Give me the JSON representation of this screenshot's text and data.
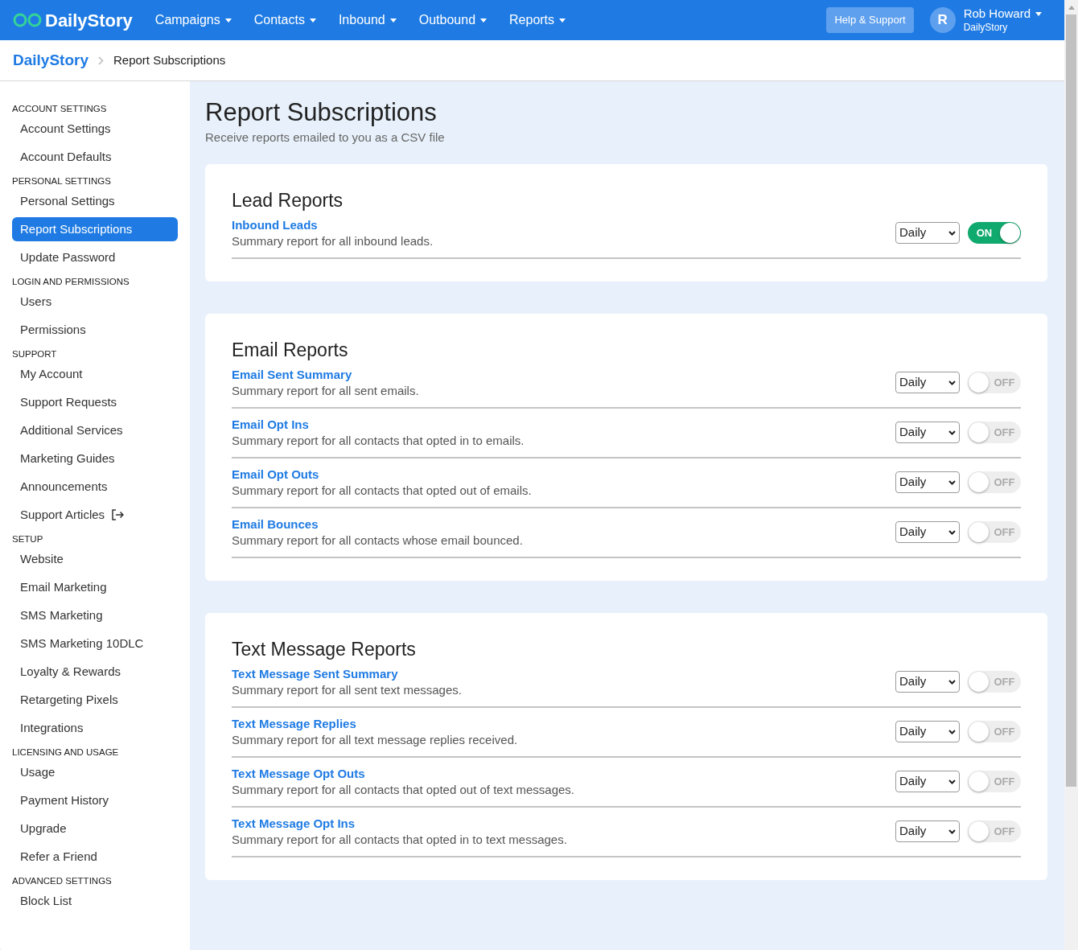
{
  "header": {
    "brand": "DailyStory",
    "nav": [
      "Campaigns",
      "Contacts",
      "Inbound",
      "Outbound",
      "Reports"
    ],
    "help_button": "Help & Support",
    "user": {
      "initial": "R",
      "name": "Rob Howard",
      "org": "DailyStory"
    }
  },
  "breadcrumb": {
    "root": "DailyStory",
    "current": "Report Subscriptions"
  },
  "sidebar": [
    {
      "heading": "ACCOUNT SETTINGS",
      "items": [
        {
          "label": "Account Settings",
          "selected": false
        },
        {
          "label": "Account Defaults",
          "selected": false
        }
      ]
    },
    {
      "heading": "PERSONAL SETTINGS",
      "items": [
        {
          "label": "Personal Settings",
          "selected": false
        },
        {
          "label": "Report Subscriptions",
          "selected": true
        },
        {
          "label": "Update Password",
          "selected": false
        }
      ]
    },
    {
      "heading": "LOGIN AND PERMISSIONS",
      "items": [
        {
          "label": "Users",
          "selected": false
        },
        {
          "label": "Permissions",
          "selected": false
        }
      ]
    },
    {
      "heading": "SUPPORT",
      "items": [
        {
          "label": "My Account",
          "selected": false
        },
        {
          "label": "Support Requests",
          "selected": false
        },
        {
          "label": "Additional Services",
          "selected": false
        },
        {
          "label": "Marketing Guides",
          "selected": false
        },
        {
          "label": "Announcements",
          "selected": false
        },
        {
          "label": "Support Articles",
          "selected": false,
          "external": true
        }
      ]
    },
    {
      "heading": "SETUP",
      "items": [
        {
          "label": "Website",
          "selected": false
        },
        {
          "label": "Email Marketing",
          "selected": false
        },
        {
          "label": "SMS Marketing",
          "selected": false
        },
        {
          "label": "SMS Marketing 10DLC",
          "selected": false
        },
        {
          "label": "Loyalty & Rewards",
          "selected": false
        },
        {
          "label": "Retargeting Pixels",
          "selected": false
        },
        {
          "label": "Integrations",
          "selected": false
        }
      ]
    },
    {
      "heading": "LICENSING AND USAGE",
      "items": [
        {
          "label": "Usage",
          "selected": false
        },
        {
          "label": "Payment History",
          "selected": false
        },
        {
          "label": "Upgrade",
          "selected": false
        },
        {
          "label": "Refer a Friend",
          "selected": false
        }
      ]
    },
    {
      "heading": "ADVANCED SETTINGS",
      "items": [
        {
          "label": "Block List",
          "selected": false
        }
      ]
    }
  ],
  "page": {
    "title": "Report Subscriptions",
    "subtitle": "Receive reports emailed to you as a CSV file"
  },
  "sections": [
    {
      "title": "Lead Reports",
      "reports": [
        {
          "name": "Inbound Leads",
          "description": "Summary report for all inbound leads.",
          "frequency": "Daily",
          "on": true,
          "switch_text": "ON"
        }
      ]
    },
    {
      "title": "Email Reports",
      "reports": [
        {
          "name": "Email Sent Summary",
          "description": "Summary report for all sent emails.",
          "frequency": "Daily",
          "on": false,
          "switch_text": "OFF"
        },
        {
          "name": "Email Opt Ins",
          "description": "Summary report for all contacts that opted in to emails.",
          "frequency": "Daily",
          "on": false,
          "switch_text": "OFF"
        },
        {
          "name": "Email Opt Outs",
          "description": "Summary report for all contacts that opted out of emails.",
          "frequency": "Daily",
          "on": false,
          "switch_text": "OFF"
        },
        {
          "name": "Email Bounces",
          "description": "Summary report for all contacts whose email bounced.",
          "frequency": "Daily",
          "on": false,
          "switch_text": "OFF"
        }
      ]
    },
    {
      "title": "Text Message Reports",
      "reports": [
        {
          "name": "Text Message Sent Summary",
          "description": "Summary report for all sent text messages.",
          "frequency": "Daily",
          "on": false,
          "switch_text": "OFF"
        },
        {
          "name": "Text Message Replies",
          "description": "Summary report for all text message replies received.",
          "frequency": "Daily",
          "on": false,
          "switch_text": "OFF"
        },
        {
          "name": "Text Message Opt Outs",
          "description": "Summary report for all contacts that opted out of text messages.",
          "frequency": "Daily",
          "on": false,
          "switch_text": "OFF"
        },
        {
          "name": "Text Message Opt Ins",
          "description": "Summary report for all contacts that opted in to text messages.",
          "frequency": "Daily",
          "on": false,
          "switch_text": "OFF"
        }
      ]
    }
  ]
}
